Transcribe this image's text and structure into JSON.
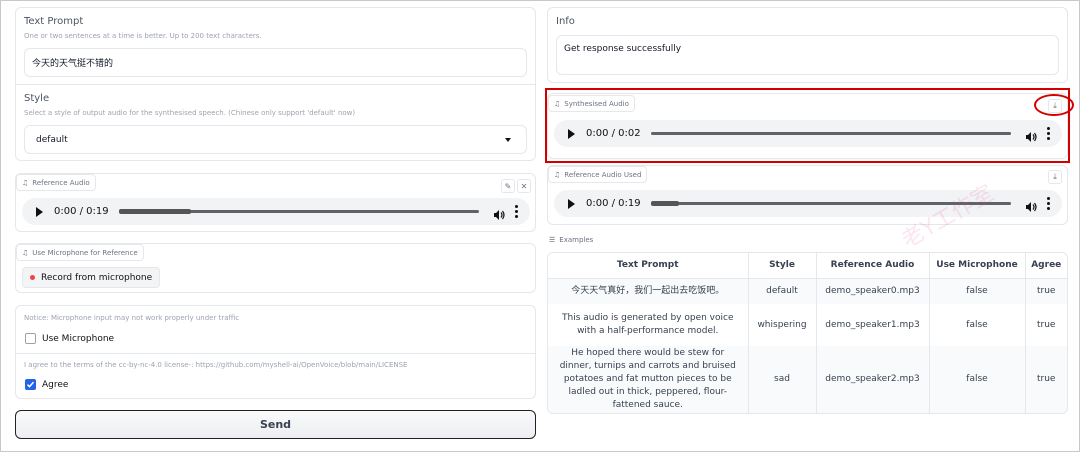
{
  "text_prompt": {
    "label": "Text Prompt",
    "hint": "One or two sentences at a time is better. Up to 200 text characters.",
    "value": "今天的天气挺不错的"
  },
  "style": {
    "label": "Style",
    "hint": "Select a style of output audio for the synthesised speech. (Chinese only support 'default' now)",
    "value": "default"
  },
  "reference_audio": {
    "label": "Reference Audio",
    "time": "0:00 / 0:19",
    "progress": 0.2
  },
  "microphone": {
    "label": "Use Microphone for Reference",
    "record_button": "Record from microphone"
  },
  "notice": {
    "text": "Notice: Microphone input may not work properly under traffic",
    "use_mic_label": "Use Microphone",
    "use_mic_checked": false,
    "license_text": "I agree to the terms of the cc-by-nc-4.0 license-: https://github.com/myshell-ai/OpenVoice/blob/main/LICENSE",
    "agree_label": "Agree",
    "agree_checked": true
  },
  "send_button": "Send",
  "info": {
    "label": "Info",
    "value": "Get response successfully"
  },
  "synthesised_audio": {
    "label": "Synthesised Audio",
    "time": "0:00 / 0:02",
    "progress": 0.0
  },
  "reference_audio_used": {
    "label": "Reference Audio Used",
    "time": "0:00 / 0:19",
    "progress": 0.08
  },
  "examples": {
    "label": "Examples",
    "headers": [
      "Text Prompt",
      "Style",
      "Reference Audio",
      "Use Microphone",
      "Agree"
    ],
    "rows": [
      [
        "今天天气真好，我们一起出去吃饭吧。",
        "default",
        "demo_speaker0.mp3",
        "false",
        "true"
      ],
      [
        "This audio is generated by open voice with a half-performance model.",
        "whispering",
        "demo_speaker1.mp3",
        "false",
        "true"
      ],
      [
        "He hoped there would be stew for dinner, turnips and carrots and bruised potatoes and fat mutton pieces to be ladled out in thick, peppered, flour-fattened sauce.",
        "sad",
        "demo_speaker2.mp3",
        "false",
        "true"
      ]
    ]
  },
  "watermark": "老Y工作室",
  "colors": {
    "highlight": "#d40000",
    "checkbox_on": "#2563eb",
    "record_dot": "#ef4444"
  }
}
